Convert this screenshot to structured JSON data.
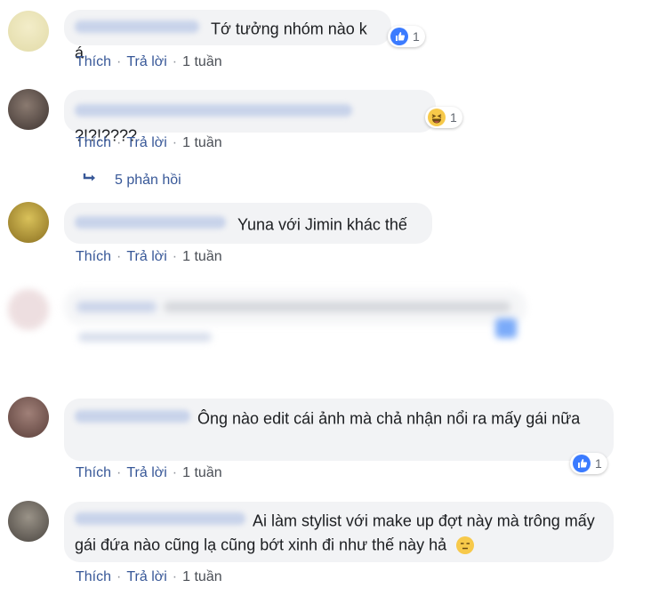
{
  "comments": [
    {
      "text": "Tớ tưởng nhóm nào k á",
      "reaction": {
        "type": "like",
        "count": "1"
      },
      "actions": {
        "like": "Thích",
        "reply": "Trả lời",
        "time": "1 tuần"
      }
    },
    {
      "text": "?!?!????",
      "reaction": {
        "type": "haha",
        "count": "1"
      },
      "actions": {
        "like": "Thích",
        "reply": "Trả lời",
        "time": "1 tuần"
      },
      "replies_label": "5 phản hồi"
    },
    {
      "text": "Yuna với Jimin khác thế",
      "actions": {
        "like": "Thích",
        "reply": "Trả lời",
        "time": "1 tuần"
      }
    },
    {
      "text": "Ông nào edit cái ảnh mà chả nhận nổi ra mấy gái nữa",
      "reaction": {
        "type": "like",
        "count": "1"
      },
      "actions": {
        "like": "Thích",
        "reply": "Trả lời",
        "time": "1 tuần"
      }
    },
    {
      "text": "Ai làm stylist với make up đợt này mà trông mấy gái đứa nào cũng lạ cũng bớt xinh đi như thế này hả",
      "emoji": "😑",
      "actions": {
        "like": "Thích",
        "reply": "Trả lời",
        "time": "1 tuần"
      }
    }
  ],
  "colors": {
    "bubble": "#f2f3f5",
    "link": "#385898",
    "like_blue": "#3b7bff",
    "haha_yellow": "#f7c94a"
  }
}
